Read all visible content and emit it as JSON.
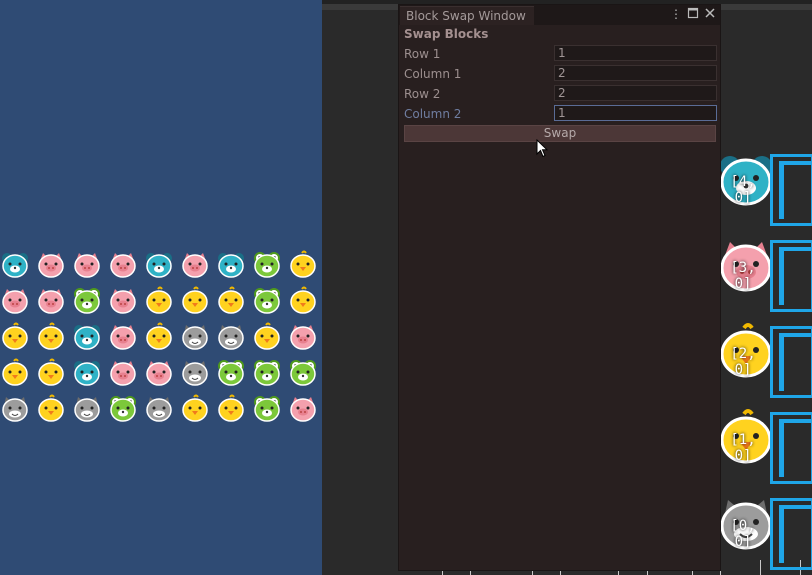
{
  "window": {
    "tab_title": "Block Swap Window",
    "icons": [
      "kebab-menu-icon",
      "maximize-icon",
      "close-icon"
    ],
    "section_title": "Swap Blocks",
    "fields": [
      {
        "label": "Row 1",
        "value": "1"
      },
      {
        "label": "Column 1",
        "value": "2"
      },
      {
        "label": "Row 2",
        "value": "2"
      },
      {
        "label": "Column 2",
        "value": "1"
      }
    ],
    "swap_label": "Swap"
  },
  "game": {
    "grid": [
      [
        "bear",
        "pig",
        "pig",
        "pig",
        "bear",
        "pig",
        "bear",
        "frog",
        "chick"
      ],
      [
        "pig",
        "pig",
        "frog",
        "pig",
        "chick",
        "chick",
        "chick",
        "frog",
        "chick"
      ],
      [
        "chick",
        "chick",
        "bear",
        "pig",
        "chick",
        "cat",
        "cat",
        "chick",
        "pig"
      ],
      [
        "chick",
        "chick",
        "bear",
        "pig",
        "pig",
        "cat",
        "frog",
        "frog",
        "frog"
      ],
      [
        "cat",
        "chick",
        "cat",
        "frog",
        "cat",
        "chick",
        "chick",
        "frog",
        "pig"
      ]
    ]
  },
  "scene": {
    "cells": [
      {
        "animal": "bear",
        "label": "[4, 0]"
      },
      {
        "animal": "pig",
        "label": "[3, 0]"
      },
      {
        "animal": "chick",
        "label": "[2, 0]"
      },
      {
        "animal": "chick",
        "label": "[1, 0]"
      },
      {
        "animal": "cat",
        "label": "[0, 0]"
      }
    ]
  },
  "colors": {
    "game_bg": "#2f4b74",
    "editor_bg": "#281f1f",
    "frame_blue": "#1fa6e8"
  }
}
